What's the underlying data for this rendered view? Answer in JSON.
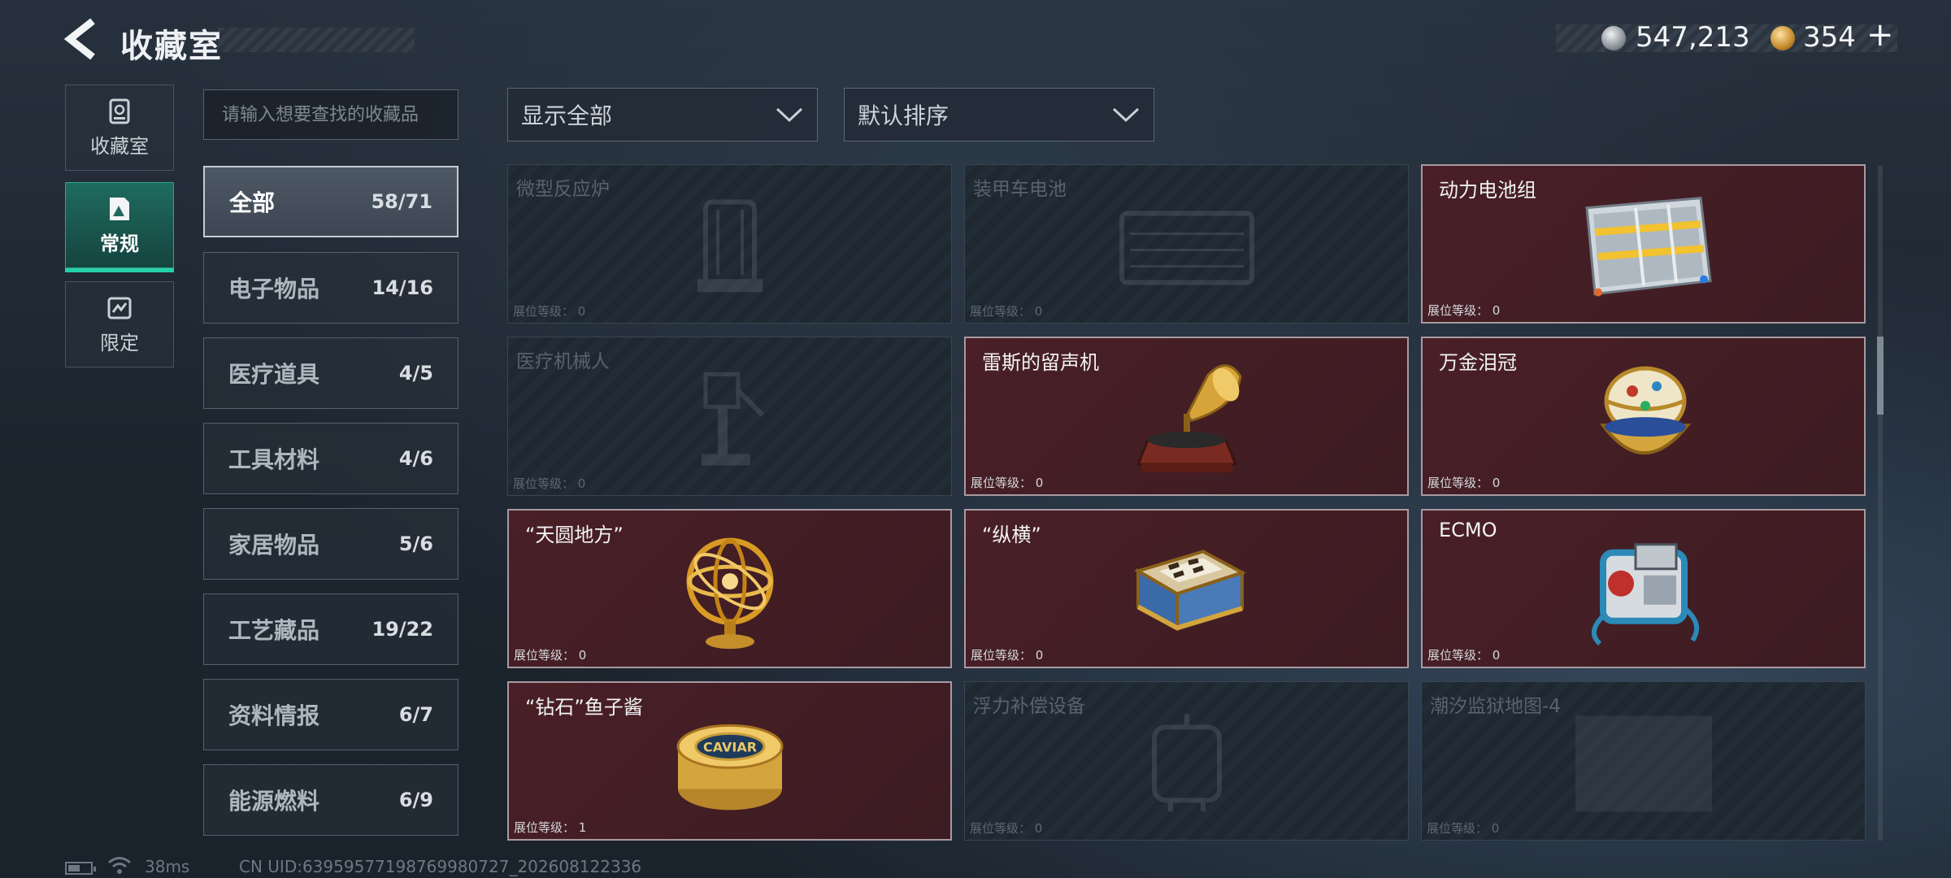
{
  "header": {
    "title": "收藏室",
    "currencies": [
      {
        "icon": "silver-coin-icon",
        "value": "547,213"
      },
      {
        "icon": "gold-coin-icon",
        "value": "354",
        "action": "+"
      }
    ]
  },
  "nav": [
    {
      "label": "收藏室",
      "icon": "collection-room-icon",
      "active": false
    },
    {
      "label": "常规",
      "icon": "regular-icon",
      "active": true
    },
    {
      "label": "限定",
      "icon": "limited-icon",
      "active": false
    }
  ],
  "search": {
    "placeholder": "请输入想要查找的收藏品"
  },
  "categories": [
    {
      "name": "全部",
      "count": "58/71",
      "active": true
    },
    {
      "name": "电子物品",
      "count": "14/16"
    },
    {
      "name": "医疗道具",
      "count": "4/5"
    },
    {
      "name": "工具材料",
      "count": "4/6"
    },
    {
      "name": "家居物品",
      "count": "5/6"
    },
    {
      "name": "工艺藏品",
      "count": "19/22"
    },
    {
      "name": "资料情报",
      "count": "6/7"
    },
    {
      "name": "能源燃料",
      "count": "6/9"
    }
  ],
  "filters": {
    "show": "显示全部",
    "sort": "默认排序"
  },
  "items": [
    {
      "name": "微型反应炉",
      "level_label": "展位等级：",
      "level": "0",
      "owned": false,
      "icon": "reactor-icon"
    },
    {
      "name": "装甲车电池",
      "level_label": "展位等级：",
      "level": "0",
      "owned": false,
      "icon": "vehicle-battery-icon"
    },
    {
      "name": "动力电池组",
      "level_label": "展位等级：",
      "level": "0",
      "owned": true,
      "icon": "battery-pack-icon"
    },
    {
      "name": "医疗机械人",
      "level_label": "展位等级：",
      "level": "0",
      "owned": false,
      "icon": "medical-robot-icon"
    },
    {
      "name": "雷斯的留声机",
      "level_label": "展位等级：",
      "level": "0",
      "owned": true,
      "icon": "gramophone-icon"
    },
    {
      "name": "万金泪冠",
      "level_label": "展位等级：",
      "level": "0",
      "owned": true,
      "icon": "jeweled-egg-icon"
    },
    {
      "name": "“天圆地方”",
      "level_label": "展位等级：",
      "level": "0",
      "owned": true,
      "icon": "armillary-sphere-icon"
    },
    {
      "name": "“纵横”",
      "level_label": "展位等级：",
      "level": "0",
      "owned": true,
      "icon": "chess-box-icon"
    },
    {
      "name": "ECMO",
      "level_label": "展位等级：",
      "level": "0",
      "owned": true,
      "icon": "ecmo-icon"
    },
    {
      "name": "“钻石”鱼子酱",
      "level_label": "展位等级：",
      "level": "1",
      "owned": true,
      "icon": "caviar-tin-icon"
    },
    {
      "name": "浮力补偿设备",
      "level_label": "展位等级：",
      "level": "0",
      "owned": false,
      "icon": "buoyancy-device-icon"
    },
    {
      "name": "潮汐监狱地图-4",
      "level_label": "展位等级：",
      "level": "0",
      "owned": false,
      "icon": "map-icon"
    }
  ],
  "caviar_label": "CAVIAR",
  "status": {
    "battery_level": 0.55,
    "ping": "38ms",
    "uid": "CN UID:63959577198769980727_202608122336"
  },
  "colors": {
    "accent": "#25d0a8",
    "owned_card": "#4a1f27",
    "empty_card": "#222c36"
  }
}
